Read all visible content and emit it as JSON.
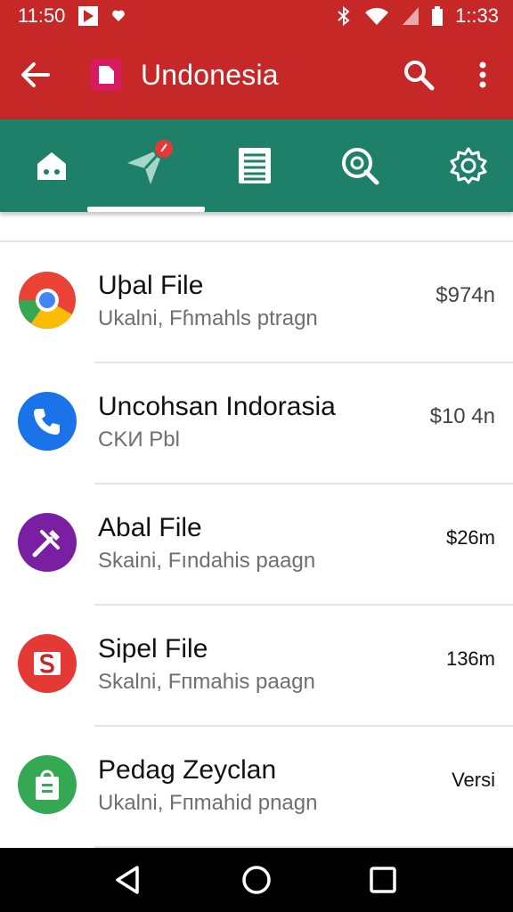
{
  "status_bar": {
    "time_left": "11:50",
    "time_right": "1::33",
    "icons": [
      "media-icon",
      "heart-icon",
      "bluetooth-icon",
      "wifi-icon",
      "signal-icon",
      "battery-icon"
    ]
  },
  "app_bar": {
    "title": "Undonesia",
    "icons": [
      "back-arrow-icon",
      "app-icon",
      "search-icon",
      "more-vert-icon"
    ]
  },
  "tabs": [
    {
      "icon": "home-icon"
    },
    {
      "icon": "send-icon",
      "selected": true,
      "badge": true
    },
    {
      "icon": "document-icon"
    },
    {
      "icon": "search-icon"
    },
    {
      "icon": "settings-icon"
    }
  ],
  "list": [
    {
      "title": "Uþal File",
      "subtitle": "Ukalni, Fɦmahls ptragn",
      "meta": "$974n",
      "icon": "chrome-icon",
      "color": "#ea4335"
    },
    {
      "title": "Uncohsan Indorasia",
      "subtitle": "CKИ Pbl",
      "meta": "$10 4n",
      "icon": "phone-icon",
      "color": "#1a73e8"
    },
    {
      "title": "Abal File",
      "subtitle": "Skaini, Fındahis paagn",
      "meta": "$26m",
      "icon": "tools-icon",
      "color": "#7b1fa2"
    },
    {
      "title": "Sipel File",
      "subtitle": "Skalni, Fпmahis paagn",
      "meta": "136m",
      "icon": "s-app-icon",
      "color": "#e53935"
    },
    {
      "title": "Pedag Zeyclan",
      "subtitle": "Ukalni, Fпmahid pnagn",
      "meta": "Versi",
      "icon": "shopping-bag-icon",
      "color": "#34a853"
    }
  ],
  "colors": {
    "app_bar": "#c62828",
    "tab_bar": "#1e8069",
    "nav_bar": "#000000"
  }
}
